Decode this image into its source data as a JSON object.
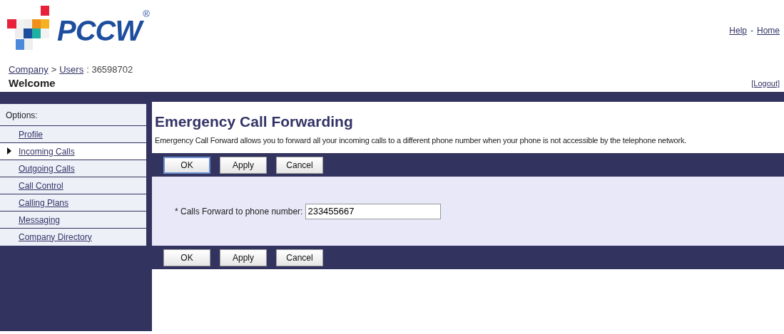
{
  "header": {
    "logo": {
      "text": "PCCW",
      "mark": "®"
    },
    "links": [
      {
        "label": "Help",
        "kind": "link"
      },
      {
        "label": "-",
        "kind": "separator"
      },
      {
        "label": "Home",
        "kind": "link"
      }
    ],
    "breadcrumb": [
      {
        "label": "Company",
        "kind": "link"
      },
      {
        "label": ">",
        "kind": "separator"
      },
      {
        "label": "Users",
        "kind": "link"
      },
      {
        "label": ": 36598702",
        "kind": "text"
      }
    ],
    "welcome": "Welcome",
    "logout": "[Logout]"
  },
  "sidebar": {
    "title": "Options:",
    "items": [
      {
        "label": "Profile",
        "selected": false
      },
      {
        "label": "Incoming Calls",
        "selected": true
      },
      {
        "label": "Outgoing Calls",
        "selected": false
      },
      {
        "label": "Call Control",
        "selected": false
      },
      {
        "label": "Calling Plans",
        "selected": false
      },
      {
        "label": "Messaging",
        "selected": false
      },
      {
        "label": "Company Directory",
        "selected": false
      }
    ]
  },
  "main": {
    "title": "Emergency Call Forwarding",
    "description": "Emergency Call Forward allows you to forward all your incoming calls to a different phone number when your phone is not accessible by the telephone network.",
    "top_buttons": [
      {
        "label": "OK",
        "focused": true
      },
      {
        "label": "Apply",
        "focused": false
      },
      {
        "label": "Cancel",
        "focused": false
      }
    ],
    "field": {
      "label": "* Calls Forward to phone number:",
      "value": "233455667"
    },
    "bottom_buttons": [
      {
        "label": "OK",
        "focused": false
      },
      {
        "label": "Apply",
        "focused": false
      },
      {
        "label": "Cancel",
        "focused": false
      }
    ]
  }
}
